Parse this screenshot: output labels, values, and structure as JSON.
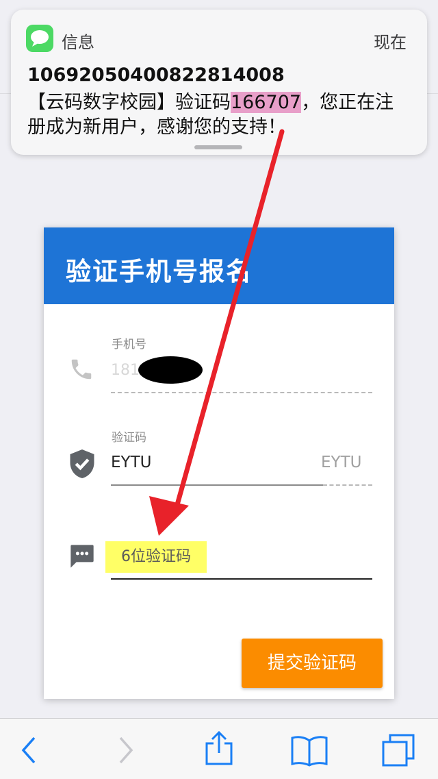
{
  "notification": {
    "app_name": "信息",
    "time": "现在",
    "sender": "1069205040082281400​8",
    "message_prefix": "【云码数字校园】验证码",
    "code": "166707",
    "message_suffix": "，您正在注册成为新用户，感谢您的支持！",
    "icon": "messages-icon"
  },
  "card": {
    "title": "验证手机号报名",
    "phone": {
      "label": "手机号",
      "value": "181",
      "icon": "phone-icon"
    },
    "captcha": {
      "label": "验证码",
      "value": "EYTU",
      "image_text": "EYTU",
      "icon": "shield-check-icon"
    },
    "sms": {
      "placeholder": "6位验证码",
      "icon": "chat-bubble-icon"
    },
    "submit_label": "提交验证码"
  },
  "colors": {
    "header": "#1e74d6",
    "submit": "#fb8c00",
    "highlight_code": "#e89fc9",
    "highlight_input": "#ffff66",
    "arrow": "#e8222a"
  },
  "toolbar": {
    "items": [
      "back-icon",
      "forward-icon",
      "share-icon",
      "bookmarks-icon",
      "tabs-icon"
    ]
  }
}
